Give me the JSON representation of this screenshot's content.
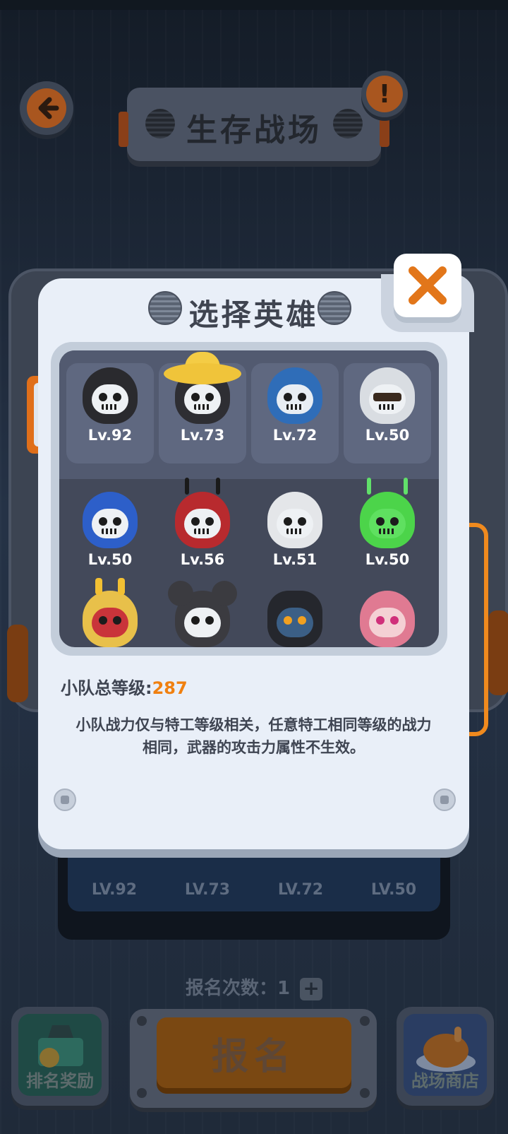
{
  "header": {
    "title": "生存战场",
    "back_icon": "back-arrow-icon",
    "info_icon": "exclamation-icon"
  },
  "modal": {
    "title": "选择英雄",
    "close_icon": "close-x-icon",
    "team": [
      {
        "level": "Lv.92",
        "hero": "black-hood-skull"
      },
      {
        "level": "Lv.73",
        "hero": "straw-hat-skull"
      },
      {
        "level": "Lv.72",
        "hero": "captain-blue-skull"
      },
      {
        "level": "Lv.50",
        "hero": "white-hood-sunglasses"
      }
    ],
    "roster": [
      {
        "level": "Lv.50",
        "hero": "blue-hood-skull"
      },
      {
        "level": "Lv.56",
        "hero": "red-hood-skull"
      },
      {
        "level": "Lv.51",
        "hero": "white-hood-skull"
      },
      {
        "level": "Lv.50",
        "hero": "green-alien-skull"
      },
      {
        "level": "",
        "hero": "yellow-antenna-skull"
      },
      {
        "level": "",
        "hero": "mouse-ears-skull"
      },
      {
        "level": "",
        "hero": "headphone-mech"
      },
      {
        "level": "",
        "hero": "pink-hood-ninja"
      }
    ],
    "total_level_label": "小队总等级:",
    "total_level_value": "287",
    "note_line1": "小队战力仅与特工等级相关，任意特工相同等级的战力",
    "note_line2": "相同，武器的攻击力属性不生效。"
  },
  "background": {
    "team_levels": [
      "LV.92",
      "LV.73",
      "LV.72",
      "LV.50"
    ],
    "signup_count_label": "报名次数：1",
    "plus_label": "+",
    "rank_reward_label": "排名奖励",
    "signup_button_label": "报名",
    "shop_label": "战场商店"
  },
  "colors": {
    "accent_orange": "#f08010",
    "modal_bg": "#e9eff8",
    "panel_dark": "#43495a"
  }
}
